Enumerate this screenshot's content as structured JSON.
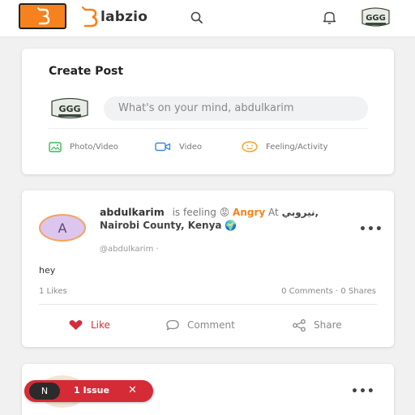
{
  "header": {
    "menu_icon": "b-logo-icon",
    "brand_text": "labzio",
    "accent": "#f5821f",
    "search_icon": "search-icon",
    "bell_icon": "bell-icon",
    "avatar_text": "GGG"
  },
  "create_post": {
    "title": "Create Post",
    "input_placeholder": "What's on your mind, abdulkarim",
    "actions": [
      {
        "label": "Photo/Video",
        "icon": "photo-icon",
        "color": "#3fb65a"
      },
      {
        "label": "Video",
        "icon": "video-camera-icon",
        "color": "#3a86e0"
      },
      {
        "label": "Feeling/Activity",
        "icon": "smiley-icon",
        "color": "#f2a21e"
      }
    ]
  },
  "post": {
    "avatar_initial": "A",
    "author": "abdulkarim",
    "is_feeling": "is feeling",
    "feeling_emoji": "😡",
    "feeling": "Angry",
    "at": "At",
    "location": "نيروبي, Nairobi County, Kenya",
    "location_emoji": "🌍",
    "handle": "@abdulkarim ·",
    "body": "hey",
    "likes": "1 Likes",
    "stats": "0 Comments · 0 Shares",
    "like_label": "Like",
    "comment_label": "Comment",
    "share_label": "Share",
    "more": "•••"
  },
  "post2": {
    "more": "•••"
  },
  "issue_badge": {
    "logo": "N",
    "label": "1 Issue",
    "close": "✕"
  }
}
